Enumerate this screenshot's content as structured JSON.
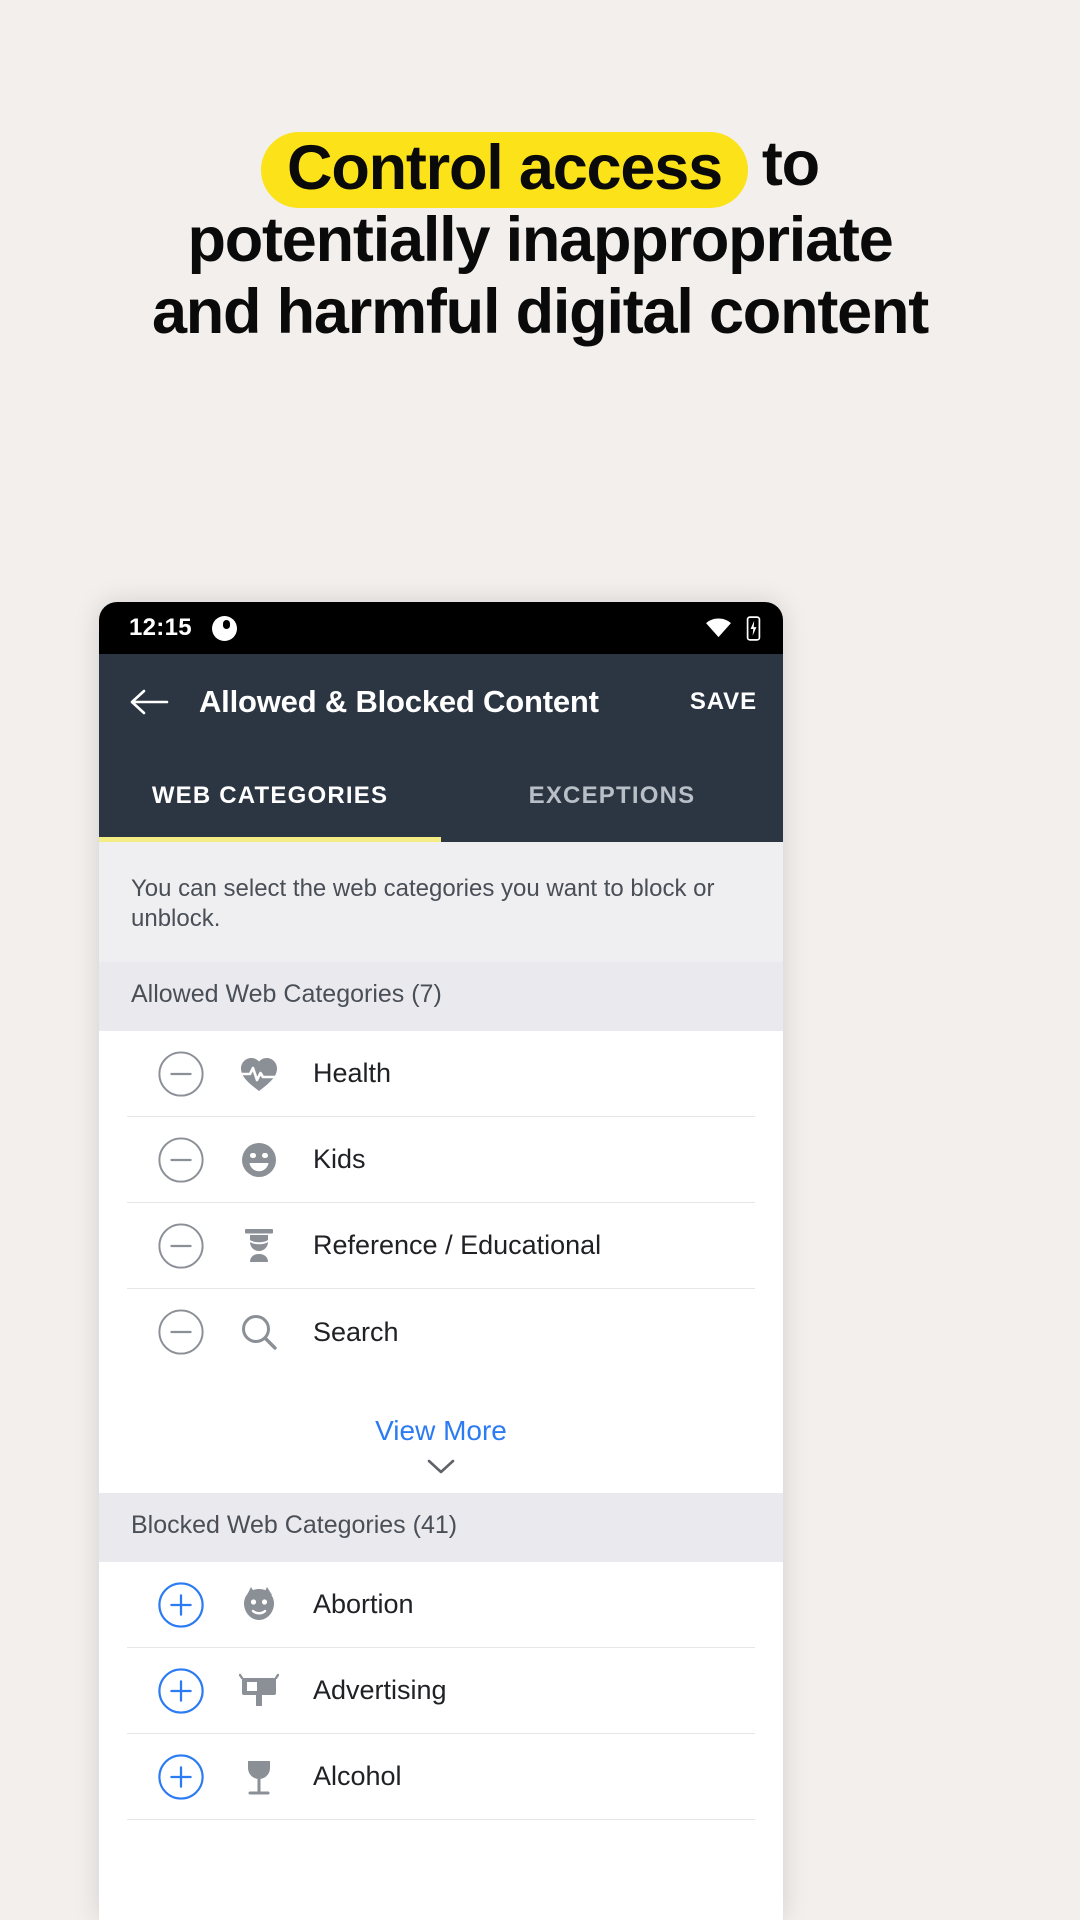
{
  "promo": {
    "headline_line1_highlight": "Control access",
    "headline_line1_rest": "to",
    "headline_line2": "potentially inappropriate",
    "headline_line3": "and harmful digital content",
    "highlight_color": "#fbe219",
    "text_color": "#0a0a0a",
    "background_color": "#f2efed"
  },
  "statusbar": {
    "time": "12:15",
    "notification_icon": "circle-notification-icon",
    "wifi_icon": "wifi-icon",
    "battery_icon": "battery-icon"
  },
  "appbar": {
    "back_icon": "back-arrow-icon",
    "title": "Allowed & Blocked Content",
    "save_label": "SAVE",
    "background_color": "#2c3542"
  },
  "tabs": {
    "items": [
      {
        "label": "WEB CATEGORIES",
        "active": true
      },
      {
        "label": "EXCEPTIONS",
        "active": false
      }
    ],
    "indicator_color": "#f4ec84"
  },
  "main": {
    "description": "You can select the web categories you want to block or unblock.",
    "allowed_section": {
      "header": "Allowed Web Categories (7)",
      "rows": [
        {
          "label": "Health",
          "icon": "heart-pulse-icon",
          "toggle": "minus-circle-icon"
        },
        {
          "label": "Kids",
          "icon": "smiley-face-icon",
          "toggle": "minus-circle-icon"
        },
        {
          "label": "Reference / Educational",
          "icon": "graduation-cap-icon",
          "toggle": "minus-circle-icon"
        },
        {
          "label": "Search",
          "icon": "magnifier-icon",
          "toggle": "minus-circle-icon"
        }
      ],
      "view_more_label": "View More",
      "view_more_icon": "chevron-down-icon",
      "link_color": "#2b7bf3"
    },
    "blocked_section": {
      "header": "Blocked Web Categories (41)",
      "rows": [
        {
          "label": "Abortion",
          "icon": "abortion-icon",
          "toggle": "plus-circle-icon"
        },
        {
          "label": "Advertising",
          "icon": "billboard-icon",
          "toggle": "plus-circle-icon"
        },
        {
          "label": "Alcohol",
          "icon": "wine-glass-icon",
          "toggle": "plus-circle-icon"
        }
      ],
      "toggle_color": "#2b7bf3"
    }
  }
}
